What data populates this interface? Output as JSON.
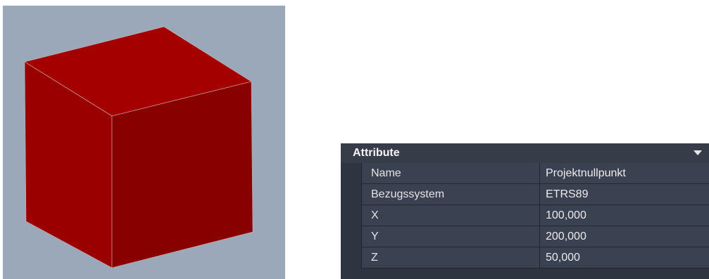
{
  "viewport": {
    "object_icon": "cube",
    "colors": {
      "background": "#9aa8ba",
      "top": "#a00000",
      "left": "#9c0000",
      "right": "#880000"
    }
  },
  "panel": {
    "title": "Attribute",
    "rows": [
      {
        "name": "Name",
        "value": "Projektnullpunkt"
      },
      {
        "name": "Bezugssystem",
        "value": "ETRS89"
      },
      {
        "name": "X",
        "value": "100,000"
      },
      {
        "name": "Y",
        "value": "200,000"
      },
      {
        "name": "Z",
        "value": "50,000"
      }
    ]
  }
}
